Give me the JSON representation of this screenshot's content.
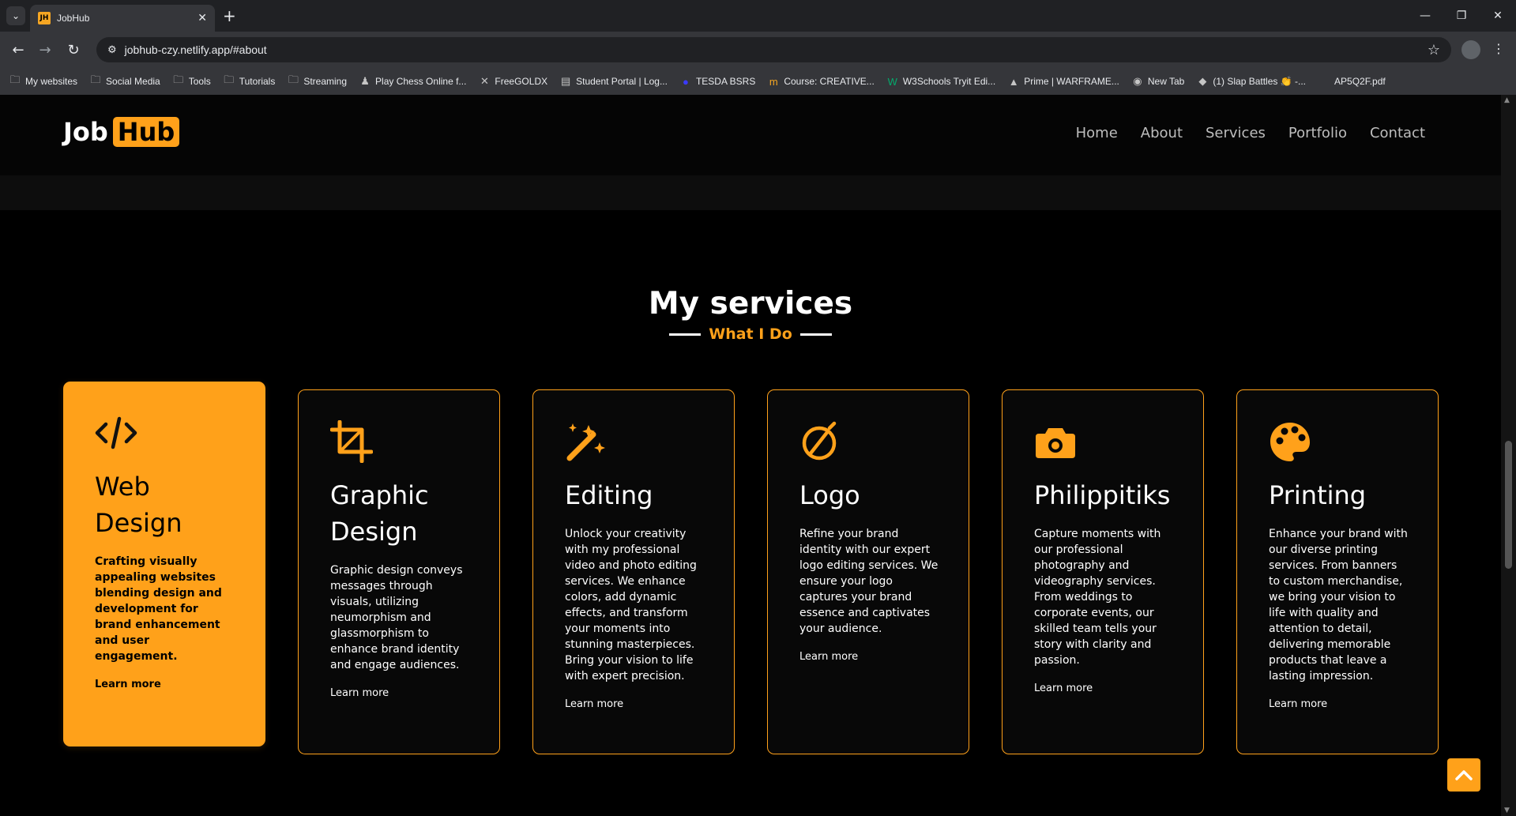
{
  "browser": {
    "tab_title": "JobHub",
    "favicon_text": "JH",
    "url": "jobhub-czy.netlify.app/#about",
    "bookmarks": [
      {
        "label": "My websites",
        "icon": "folder-icon"
      },
      {
        "label": "Social Media",
        "icon": "folder-icon"
      },
      {
        "label": "Tools",
        "icon": "folder-icon"
      },
      {
        "label": "Tutorials",
        "icon": "folder-icon"
      },
      {
        "label": "Streaming",
        "icon": "folder-icon"
      },
      {
        "label": "Play Chess Online f...",
        "icon": "chess-icon"
      },
      {
        "label": "FreeGOLDX",
        "icon": "x-icon"
      },
      {
        "label": "Student Portal | Log...",
        "icon": "page-icon"
      },
      {
        "label": "TESDA BSRS",
        "icon": "globe-icon"
      },
      {
        "label": "Course: CREATIVE...",
        "icon": "course-icon"
      },
      {
        "label": "W3Schools Tryit Edi...",
        "icon": "w3-icon"
      },
      {
        "label": "Prime | WARFRAME...",
        "icon": "prime-icon"
      },
      {
        "label": "New Tab",
        "icon": "chrome-icon"
      },
      {
        "label": "(1) Slap Battles 👏 -...",
        "icon": "roblox-icon"
      },
      {
        "label": "AP5Q2F.pdf",
        "icon": "pdf-icon"
      }
    ]
  },
  "site": {
    "logo_job": "Job",
    "logo_hub": "Hub",
    "nav": [
      "Home",
      "About",
      "Services",
      "Portfolio",
      "Contact"
    ],
    "accent": "#ffa11a"
  },
  "services": {
    "title": "My services",
    "subtitle": "What I Do",
    "cards": [
      {
        "title": "Web Design",
        "icon": "code-icon",
        "desc": "Crafting visually appealing websites blending design and development for brand enhancement and user engagement.",
        "link": "Learn more",
        "active": true
      },
      {
        "title": "Graphic Design",
        "icon": "crop-icon",
        "desc": "Graphic design conveys messages through visuals, utilizing neumorphism and glassmorphism to enhance brand identity and engage audiences.",
        "link": "Learn more",
        "active": false
      },
      {
        "title": "Editing",
        "icon": "magic-wand-icon",
        "desc": "Unlock your creativity with my professional video and photo editing services. We enhance colors, add dynamic effects, and transform your moments into stunning masterpieces. Bring your vision to life with expert precision.",
        "link": "Learn more",
        "active": false
      },
      {
        "title": "Logo",
        "icon": "compass-icon",
        "desc": "Refine your brand identity with our expert logo editing services. We ensure your logo captures your brand essence and captivates your audience.",
        "link": "Learn more",
        "active": false
      },
      {
        "title": "Philippitiks",
        "icon": "camera-icon",
        "desc": "Capture moments with our professional photography and videography services. From weddings to corporate events, our skilled team tells your story with clarity and passion.",
        "link": "Learn more",
        "active": false
      },
      {
        "title": "Printing",
        "icon": "palette-icon",
        "desc": "Enhance your brand with our diverse printing services. From banners to custom merchandise, we bring your vision to life with quality and attention to detail, delivering memorable products that leave a lasting impression.",
        "link": "Learn more",
        "active": false
      }
    ]
  }
}
